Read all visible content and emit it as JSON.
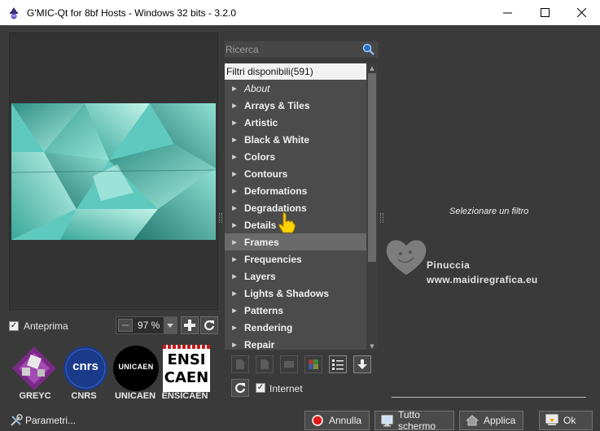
{
  "window": {
    "title": "G'MIC-Qt for 8bf Hosts - Windows 32 bits - 3.2.0",
    "controls": {
      "minimize": "—",
      "maximize": "☐",
      "close": "✕"
    }
  },
  "preview": {
    "checkbox_label": "Anteprima",
    "checked": true,
    "zoom_value": "97 %"
  },
  "logos": [
    {
      "name": "GREYC"
    },
    {
      "name": "CNRS"
    },
    {
      "name": "UNICAEN"
    },
    {
      "name": "ENSICAEN"
    }
  ],
  "logo_text": {
    "cnrs": "cnrs",
    "unicaen": "UNICAEN",
    "ensicaen_top": "ENSI",
    "ensicaen_bottom": "CAEN"
  },
  "search": {
    "placeholder": "Ricerca"
  },
  "filters": {
    "header": "Filtri disponibili(591)",
    "items": [
      {
        "label": "About",
        "italic": true
      },
      {
        "label": "Arrays & Tiles"
      },
      {
        "label": "Artistic"
      },
      {
        "label": "Black & White"
      },
      {
        "label": "Colors"
      },
      {
        "label": "Contours"
      },
      {
        "label": "Deformations"
      },
      {
        "label": "Degradations"
      },
      {
        "label": "Details"
      },
      {
        "label": "Frames",
        "selected": true
      },
      {
        "label": "Frequencies"
      },
      {
        "label": "Layers"
      },
      {
        "label": "Lights & Shadows"
      },
      {
        "label": "Patterns"
      },
      {
        "label": "Rendering"
      },
      {
        "label": "Repair"
      }
    ]
  },
  "internet": {
    "label": "Internet",
    "checked": true
  },
  "right_panel": {
    "message": "Selezionare un filtro",
    "watermark_name": "Pinuccia",
    "watermark_url": "www.maidiregrafica.eu"
  },
  "buttons": {
    "parameters": "Parametri...",
    "cancel": "Annulla",
    "fullscreen": "Tutto schermo",
    "apply": "Applica",
    "ok": "Ok"
  },
  "colors": {
    "background": "#3a3a3a",
    "preview_teal": "#5fc9bf",
    "cancel_red": "#e01a1a"
  }
}
